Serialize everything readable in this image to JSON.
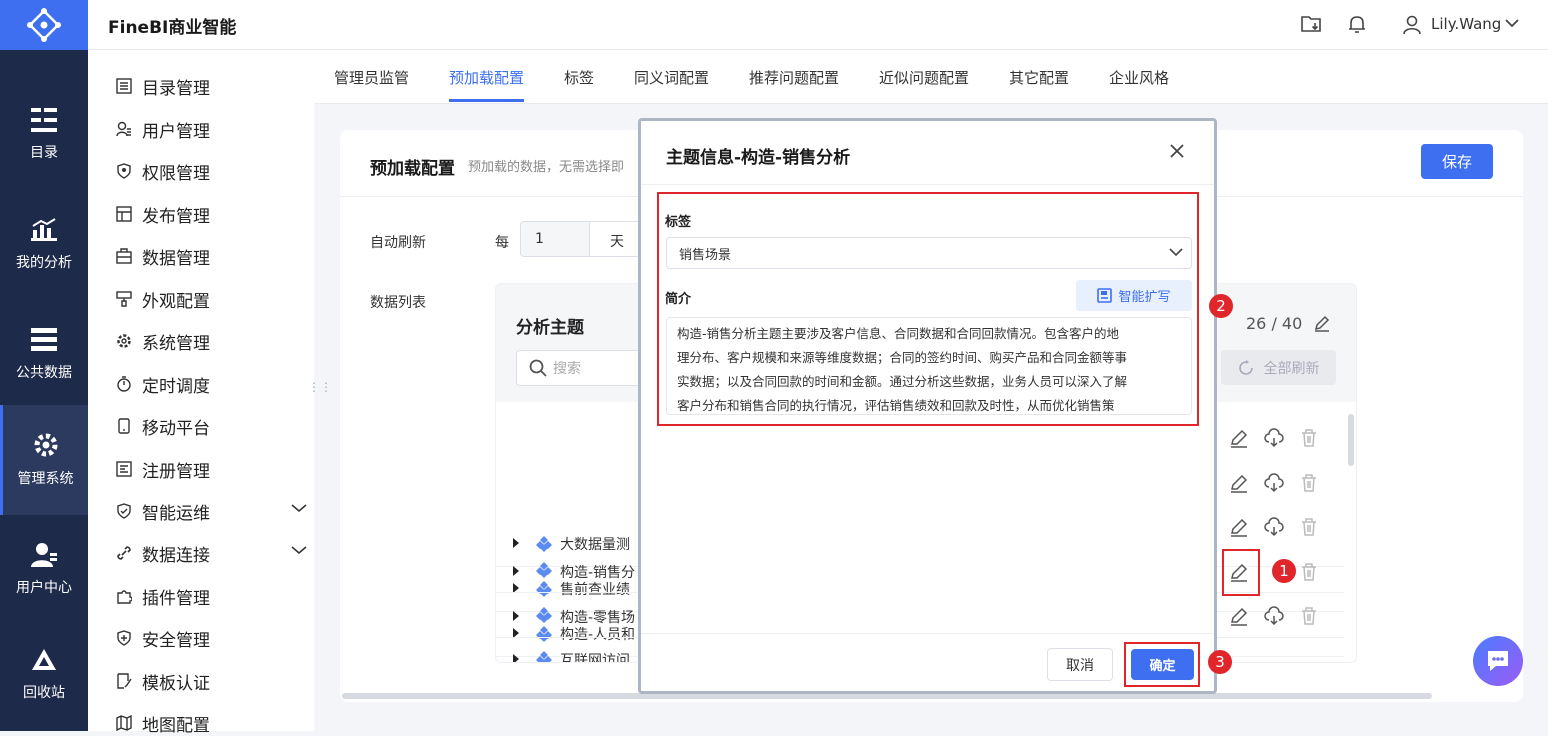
{
  "app": {
    "title": "FineBI商业智能"
  },
  "user": {
    "name": "Lily.Wang"
  },
  "rail": [
    {
      "label": "目录",
      "icon": "catalog-icon"
    },
    {
      "label": "我的分析",
      "icon": "analysis-icon"
    },
    {
      "label": "公共数据",
      "icon": "database-icon"
    },
    {
      "label": "管理系统",
      "icon": "gear-icon",
      "active": true
    },
    {
      "label": "用户中心",
      "icon": "user-center-icon"
    },
    {
      "label": "回收站",
      "icon": "recycle-icon"
    }
  ],
  "menu": [
    {
      "label": "目录管理",
      "icon": "list-icon"
    },
    {
      "label": "用户管理",
      "icon": "user-icon"
    },
    {
      "label": "权限管理",
      "icon": "shield-icon"
    },
    {
      "label": "发布管理",
      "icon": "publish-icon"
    },
    {
      "label": "数据管理",
      "icon": "briefcase-icon"
    },
    {
      "label": "外观配置",
      "icon": "brush-icon"
    },
    {
      "label": "系统管理",
      "icon": "gear-icon"
    },
    {
      "label": "定时调度",
      "icon": "timer-icon"
    },
    {
      "label": "移动平台",
      "icon": "phone-icon"
    },
    {
      "label": "注册管理",
      "icon": "register-icon"
    },
    {
      "label": "智能运维",
      "icon": "ops-icon",
      "expandable": true
    },
    {
      "label": "数据连接",
      "icon": "link-icon",
      "expandable": true
    },
    {
      "label": "插件管理",
      "icon": "puzzle-icon"
    },
    {
      "label": "安全管理",
      "icon": "security-icon"
    },
    {
      "label": "模板认证",
      "icon": "certificate-icon"
    },
    {
      "label": "地图配置",
      "icon": "map-icon"
    }
  ],
  "tabs": [
    "管理员监管",
    "预加载配置",
    "标签",
    "同义词配置",
    "推荐问题配置",
    "近似问题配置",
    "其它配置",
    "企业风格"
  ],
  "active_tab": "预加载配置",
  "card": {
    "title": "预加载配置",
    "desc": "预加载的数据，无需选择即",
    "save": "保存",
    "auto_refresh_label": "自动刷新",
    "per": "每",
    "interval_value": "1",
    "interval_unit": "天",
    "list_label": "数据列表"
  },
  "panel": {
    "title": "分析主题",
    "search_placeholder": "搜索",
    "count": "26 / 40",
    "refresh_all": "全部刷新",
    "rows": [
      "大数据量测",
      "售前查业绩",
      "构造-人员和",
      "构造-销售分",
      "构造-零售场",
      "互联网访问"
    ]
  },
  "modal": {
    "title": "主题信息-构造-销售分析",
    "tag_label": "标签",
    "tag_value": "销售场景",
    "intro_label": "简介",
    "ai_button": "智能扩写",
    "intro_lines": [
      "构造-销售分析主题主要涉及客户信息、合同数据和合同回款情况。包含客户的地",
      "理分布、客户规模和来源等维度数据；合同的签约时间、购买产品和合同金额等事",
      "实数据；以及合同回款的时间和金额。通过分析这些数据，业务人员可以深入了解",
      "客户分布和销售合同的执行情况，评估销售绩效和回款及时性，从而优化销售策"
    ],
    "cancel": "取消",
    "confirm": "确定"
  },
  "steps": [
    "1",
    "2",
    "3"
  ],
  "colors": {
    "accent": "#3d6ff0",
    "rail": "#1e2a4a",
    "highlight": "#e0252b"
  }
}
